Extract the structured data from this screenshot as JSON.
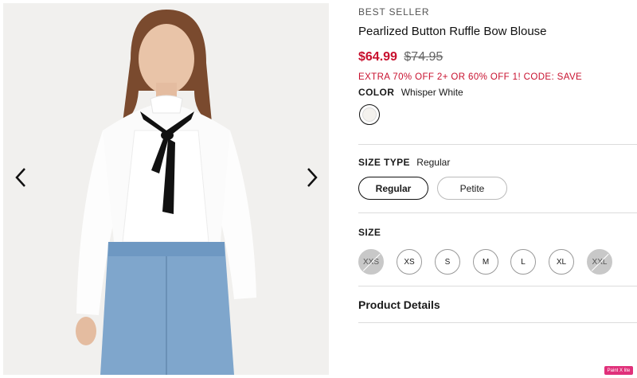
{
  "gallery": {
    "image_alt": "Model wearing white sheer blouse with black bow tie and blue jeans",
    "prev_icon": "chevron-left-icon",
    "next_icon": "chevron-right-icon"
  },
  "product": {
    "badge": "BEST SELLER",
    "title": "Pearlized Button Ruffle Bow Blouse",
    "price_sale": "$64.99",
    "price_original": "$74.95",
    "promo": "EXTRA 70% OFF 2+ OR 60% OFF 1! CODE: SAVE",
    "sale_color": "#c8102e"
  },
  "color": {
    "label": "COLOR",
    "value": "Whisper White"
  },
  "size_type": {
    "label": "SIZE TYPE",
    "value": "Regular",
    "options": [
      {
        "label": "Regular",
        "selected": true
      },
      {
        "label": "Petite",
        "selected": false
      }
    ]
  },
  "size": {
    "label": "SIZE",
    "options": [
      {
        "label": "XXS",
        "available": false
      },
      {
        "label": "XS",
        "available": true
      },
      {
        "label": "S",
        "available": true
      },
      {
        "label": "M",
        "available": true
      },
      {
        "label": "L",
        "available": true
      },
      {
        "label": "XL",
        "available": true
      },
      {
        "label": "XXL",
        "available": false
      }
    ]
  },
  "product_details": {
    "label": "Product Details"
  },
  "extension_badge": {
    "label": "Paint X lite"
  }
}
